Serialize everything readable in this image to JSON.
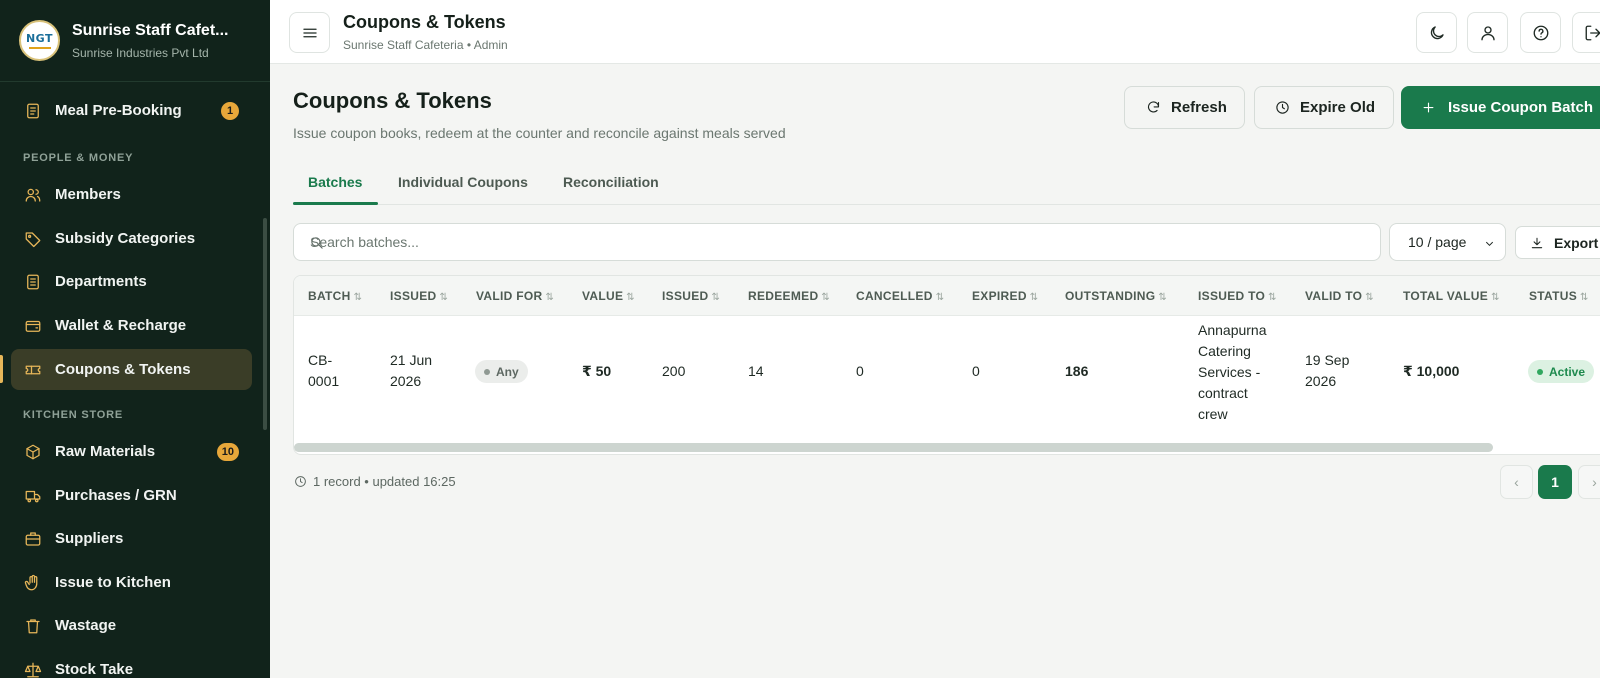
{
  "brand": {
    "logo_text": "NGT",
    "title": "Sunrise Staff Cafet...",
    "subtitle": "Sunrise Industries Pvt Ltd"
  },
  "sidebar": {
    "items": [
      {
        "label": "Meal Pre-Booking",
        "icon": "clipboard-icon",
        "badge": "1"
      },
      {
        "label": "Members",
        "icon": "users-icon"
      },
      {
        "label": "Subsidy Categories",
        "icon": "tag-icon"
      },
      {
        "label": "Departments",
        "icon": "document-icon"
      },
      {
        "label": "Wallet & Recharge",
        "icon": "wallet-icon"
      },
      {
        "label": "Coupons & Tokens",
        "icon": "ticket-icon",
        "active": true
      },
      {
        "label": "Raw Materials",
        "icon": "box-icon",
        "badge": "10"
      },
      {
        "label": "Purchases / GRN",
        "icon": "truck-icon"
      },
      {
        "label": "Suppliers",
        "icon": "briefcase-icon"
      },
      {
        "label": "Issue to Kitchen",
        "icon": "hand-icon"
      },
      {
        "label": "Wastage",
        "icon": "trash-icon"
      },
      {
        "label": "Stock Take",
        "icon": "scale-icon"
      }
    ],
    "sections": {
      "people_money": "PEOPLE & MONEY",
      "kitchen_store": "KITCHEN STORE"
    }
  },
  "topbar": {
    "title": "Coupons & Tokens",
    "subtitle": "Sunrise Staff Cafeteria • Admin",
    "icons": [
      "moon-icon",
      "user-icon",
      "help-icon",
      "logout-icon"
    ]
  },
  "main": {
    "title": "Coupons & Tokens",
    "subtitle": "Issue coupon books, redeem at the counter and reconcile against meals served",
    "buttons": {
      "refresh": "Refresh",
      "expire": "Expire Old",
      "issue": "Issue Coupon Batch"
    },
    "tabs": [
      "Batches",
      "Individual Coupons",
      "Reconciliation"
    ],
    "search_placeholder": "Search batches...",
    "page_size": "10 / page",
    "export": "Export"
  },
  "table": {
    "columns": [
      "BATCH",
      "ISSUED",
      "VALID FOR",
      "VALUE",
      "ISSUED",
      "REDEEMED",
      "CANCELLED",
      "EXPIRED",
      "OUTSTANDING",
      "ISSUED TO",
      "VALID TO",
      "TOTAL VALUE",
      "STATUS"
    ],
    "rows": [
      {
        "batch": "CB-0001",
        "issued_date": "21 Jun 2026",
        "valid_for": "Any",
        "value": "₹ 50",
        "issued": "200",
        "redeemed": "14",
        "cancelled": "0",
        "expired": "0",
        "outstanding": "186",
        "issued_to": "Annapurna Catering Services - contract crew",
        "valid_to": "19 Sep 2026",
        "total_value": "₹ 10,000",
        "status": "Active"
      }
    ]
  },
  "footer": {
    "info": "1 record • updated 16:25",
    "current_page": "1",
    "prev": "‹",
    "next": "›"
  },
  "colors": {
    "sidebar_bg": "#11231b",
    "accent": "#1a7a4c",
    "icon_gold": "#e7b659",
    "badge": "#e7a73a"
  }
}
